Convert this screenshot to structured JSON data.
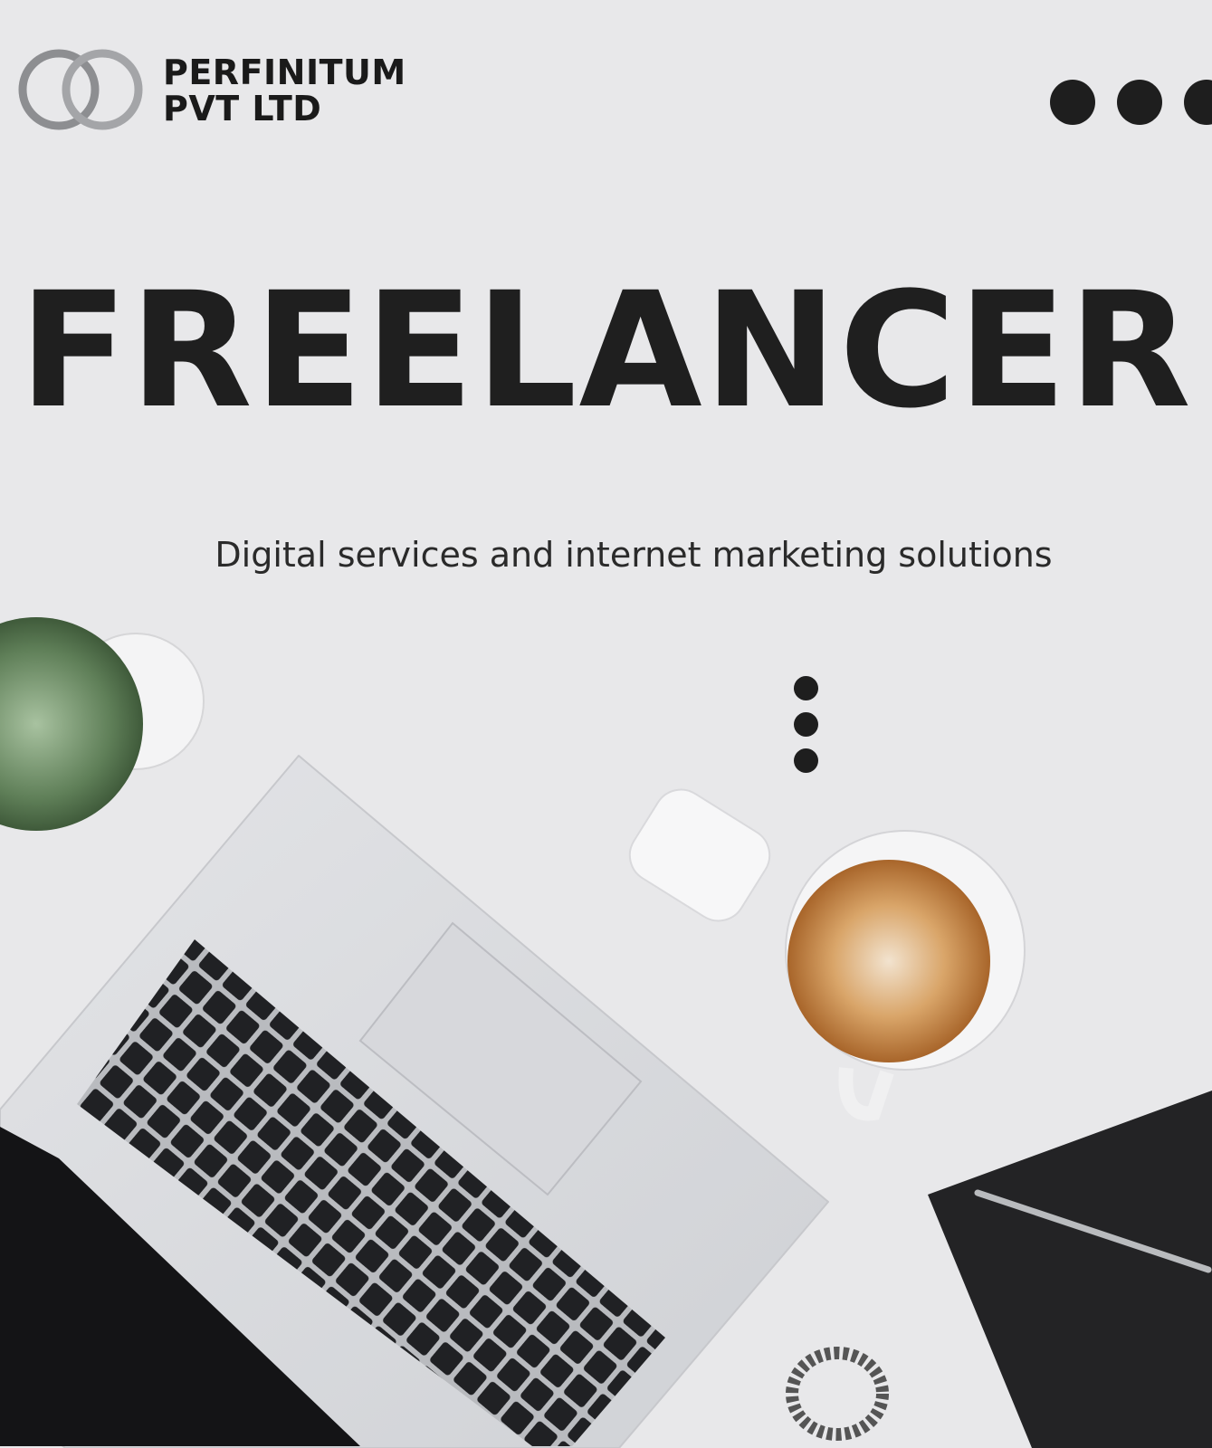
{
  "brand": {
    "line1": "PERFINITUM",
    "line2": "PVT LTD"
  },
  "headline": "FREELANCER",
  "subtitle": "Digital services and internet marketing solutions",
  "colors": {
    "background": "#e8e8ea",
    "text": "#1f1f1f",
    "accent_dots": "#1e1e1e"
  }
}
